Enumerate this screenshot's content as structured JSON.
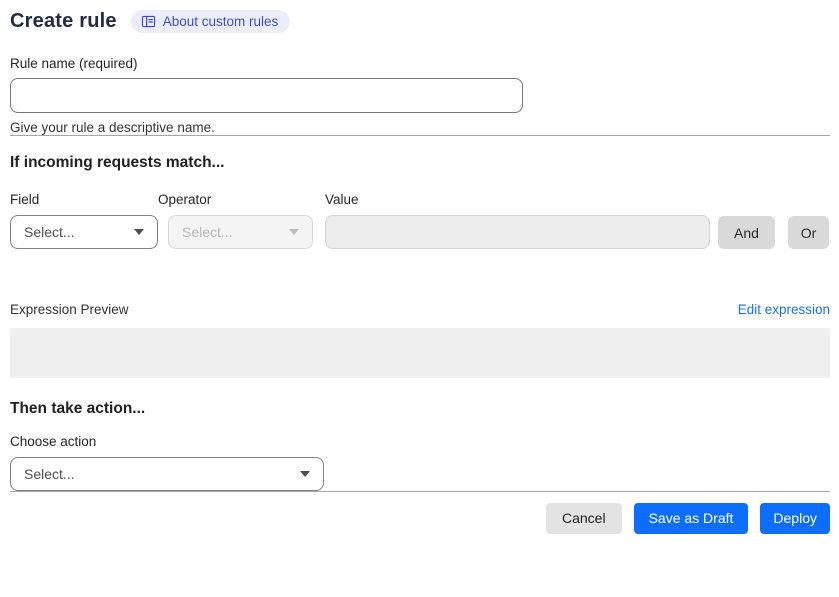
{
  "header": {
    "title": "Create rule",
    "badge_label": "About custom rules"
  },
  "rule_name": {
    "label": "Rule name (required)",
    "value": "",
    "helper": "Give your rule a descriptive name."
  },
  "match": {
    "title": "If incoming requests match...",
    "field_label": "Field",
    "field_value": "Select...",
    "operator_label": "Operator",
    "operator_value": "Select...",
    "value_label": "Value",
    "value_text": "",
    "and_label": "And",
    "or_label": "Or",
    "expression_preview_label": "Expression Preview",
    "edit_expression_label": "Edit expression",
    "expression_value": ""
  },
  "action": {
    "title": "Then take action...",
    "choose_label": "Choose action",
    "value": "Select..."
  },
  "footer": {
    "cancel_label": "Cancel",
    "save_draft_label": "Save as Draft",
    "deploy_label": "Deploy"
  },
  "icons": {
    "badge_icon": "book-icon",
    "select_icon": "chevron-down-icon"
  },
  "colors": {
    "primary_blue": "#0d6efd",
    "link_blue": "#1b6fe0",
    "badge_bg": "#ecedfa",
    "badge_text": "#3f4ec4",
    "secondary_button_gray": "#d9d9d9",
    "cancel_gray": "#e3e3e3",
    "disabled_bg": "#f4f4f4",
    "preview_box_bg": "#f0f0f0",
    "divider_gray": "#a6a6a6"
  }
}
